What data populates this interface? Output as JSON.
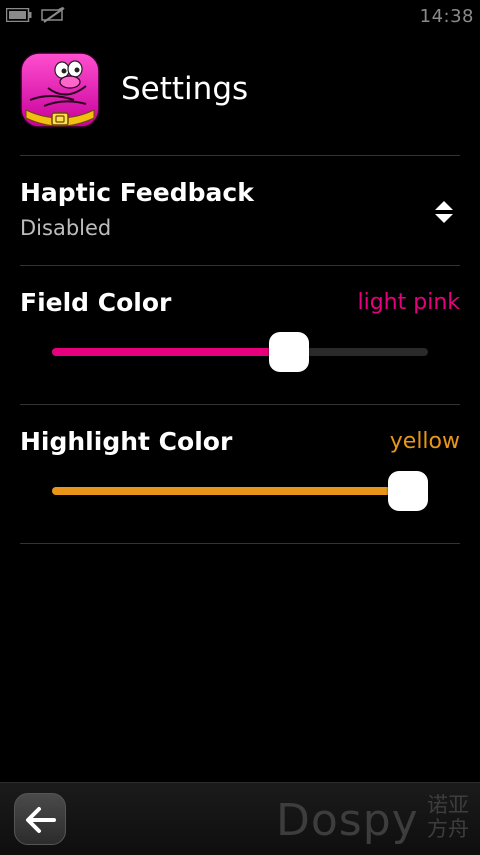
{
  "status_bar": {
    "time": "14:38",
    "battery_icon": "battery-icon",
    "signal_icon": "no-signal-icon"
  },
  "header": {
    "title": "Settings",
    "app_icon": "pink-cartoon-character-icon"
  },
  "settings": {
    "haptic": {
      "label": "Haptic Feedback",
      "value": "Disabled",
      "icon": "up-down-arrows-icon"
    },
    "field_color": {
      "label": "Field Color",
      "value": "light pink",
      "value_color": "#e6007e",
      "slider_level": 0.645
    },
    "highlight_color": {
      "label": "Highlight Color",
      "value": "yellow",
      "value_color": "#e8961a",
      "slider_level": 1.0
    }
  },
  "toolbar": {
    "back_icon": "back-arrow-icon",
    "watermark": "Dospy",
    "watermark_cn": "诺亚方舟"
  },
  "colors": {
    "background": "#000000",
    "divider": "#333333",
    "track": "#2a2a2a"
  }
}
